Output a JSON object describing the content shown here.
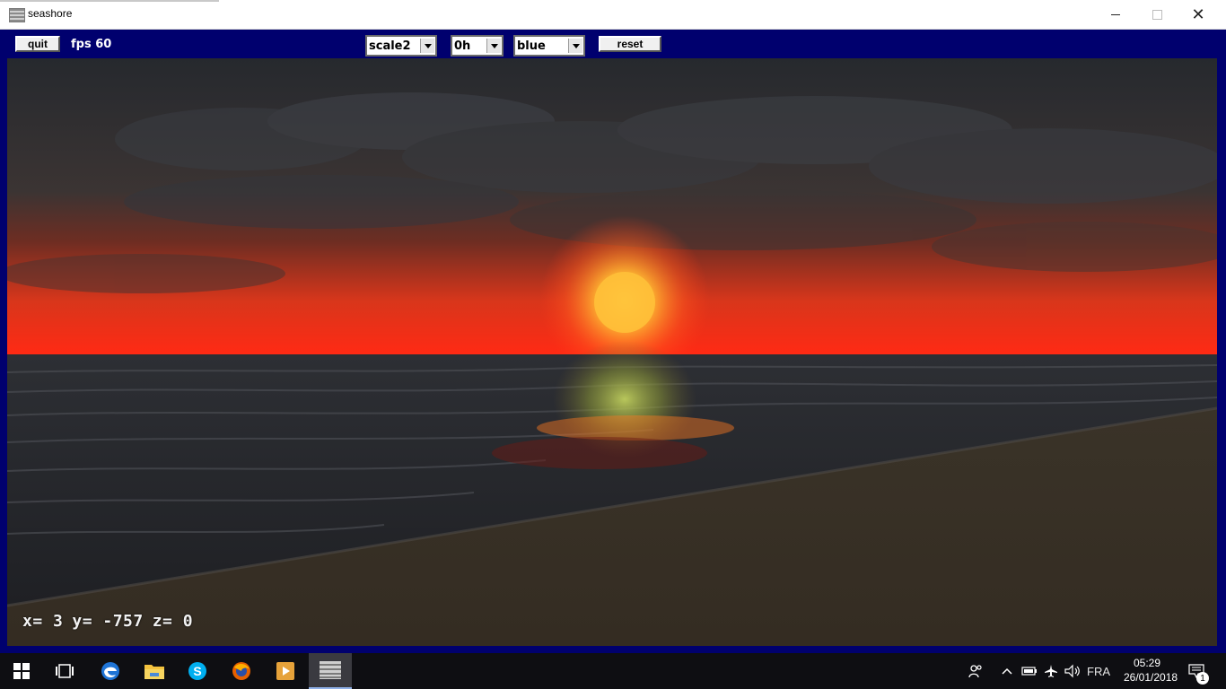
{
  "window": {
    "title": "seashore",
    "icon": "seashore-app-icon"
  },
  "toolbar": {
    "quit_label": "quit",
    "fps_text": "fps 60",
    "scale_select": {
      "value": "scale2"
    },
    "hour_select": {
      "value": "0h"
    },
    "color_select": {
      "value": "blue"
    },
    "reset_label": "reset"
  },
  "scene": {
    "coords": {
      "x": "x= 3",
      "y": "y= -757",
      "z": "z= 0"
    },
    "colors": {
      "sky_top": "#2b2e33",
      "horizon": "#ff2a14",
      "sun": "#ffc832",
      "sea": "#2a2b2f",
      "sand": "#3b3327"
    }
  },
  "taskbar": {
    "apps": [
      "start-button",
      "task-view",
      "edge",
      "file-explorer",
      "skype",
      "firefox",
      "media-player",
      "seashore"
    ],
    "tray": {
      "language": "FRA",
      "time": "05:29",
      "date": "26/01/2018",
      "notifications": "1"
    }
  }
}
